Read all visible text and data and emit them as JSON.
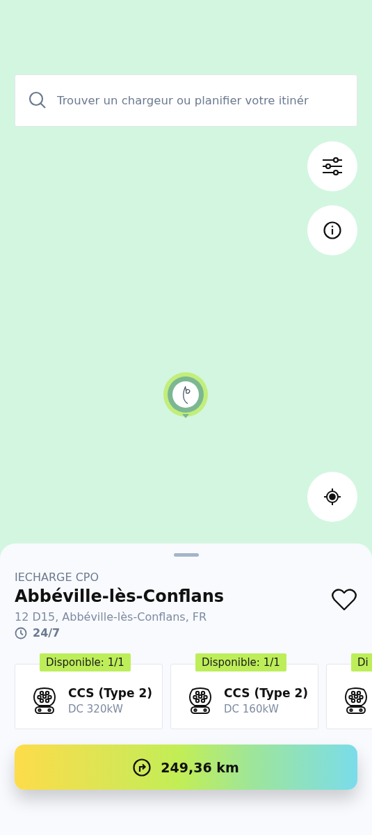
{
  "search": {
    "placeholder": "Trouver un chargeur ou planifier votre itinér"
  },
  "station": {
    "operator": "IECHARGE CPO",
    "name": "Abbéville-lès-Conflans",
    "address": "12 D15, Abbéville-lès-Conflans, FR",
    "hours": "24/7",
    "favorite": false
  },
  "connectors": [
    {
      "availability": "Disponible: 1/1",
      "type": "CCS (Type 2)",
      "power": "DC 320kW"
    },
    {
      "availability": "Disponible: 1/1",
      "type": "CCS (Type 2)",
      "power": "DC 160kW"
    },
    {
      "availability": "Di"
    }
  ],
  "route_button": {
    "label": "249,36 km"
  }
}
